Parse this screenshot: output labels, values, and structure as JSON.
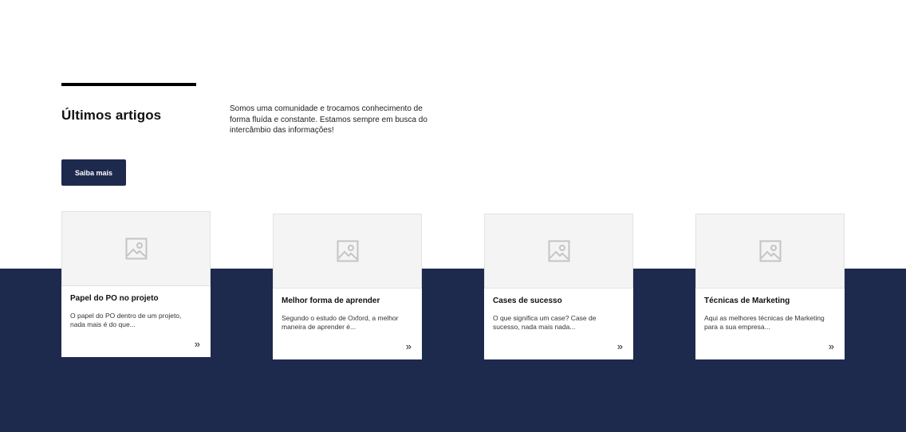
{
  "section": {
    "title": "Últimos artigos",
    "intro": "Somos uma comunidade e trocamos conhecimento de forma fluída e constante. Estamos sempre em busca do intercâmbio das informações!",
    "cta_label": "Saiba mais"
  },
  "articles": [
    {
      "title": "Papel do PO no projeto",
      "excerpt": "O papel do PO dentro de um projeto, nada mais é do que...",
      "arrow": "»",
      "image_icon": "image-placeholder-icon"
    },
    {
      "title": "Melhor forma de aprender",
      "excerpt": "Segundo o estudo de Oxford, a melhor maneira de aprender é...",
      "arrow": "»",
      "image_icon": "image-placeholder-icon"
    },
    {
      "title": "Cases de sucesso",
      "excerpt": "O que significa um case? Case de sucesso, nada mais nada...",
      "arrow": "»",
      "image_icon": "image-placeholder-icon"
    },
    {
      "title": "Técnicas de Marketing",
      "excerpt": "Aqui as melhores técnicas de Marketing para a sua empresa...",
      "arrow": "»",
      "image_icon": "image-placeholder-icon"
    }
  ],
  "colors": {
    "navy": "#1e2a4d",
    "accent_rule": "#000000",
    "image_placeholder_bg": "#f4f4f4",
    "background": "#ffffff"
  }
}
